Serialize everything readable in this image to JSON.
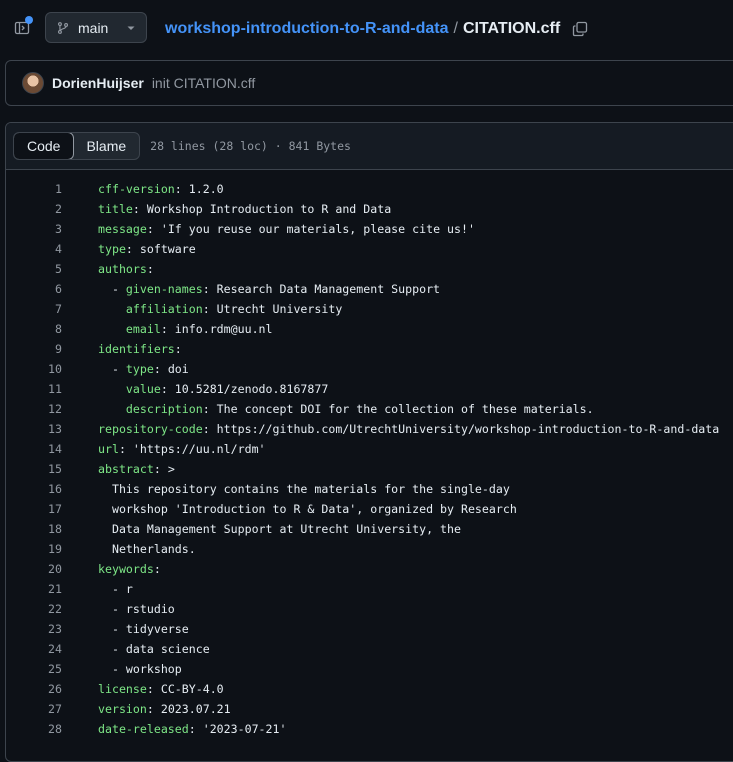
{
  "header": {
    "branch": "main",
    "repo": "workshop-introduction-to-R-and-data",
    "separator": "/",
    "file": "CITATION.cff"
  },
  "commit": {
    "author": "DorienHuijser",
    "message": "init CITATION.cff"
  },
  "file_view": {
    "tabs": [
      "Code",
      "Blame"
    ],
    "active_tab": "Code",
    "info": "28 lines (28 loc) · 841 Bytes"
  },
  "lines": [
    {
      "n": "1",
      "indent": "",
      "key": "cff-version",
      "sep": ": ",
      "val": "1.2.0"
    },
    {
      "n": "2",
      "indent": "",
      "key": "title",
      "sep": ": ",
      "val": "Workshop Introduction to R and Data"
    },
    {
      "n": "3",
      "indent": "",
      "key": "message",
      "sep": ": ",
      "val": "'If you reuse our materials, please cite us!'"
    },
    {
      "n": "4",
      "indent": "",
      "key": "type",
      "sep": ": ",
      "val": "software"
    },
    {
      "n": "5",
      "indent": "",
      "key": "authors",
      "sep": ":",
      "val": ""
    },
    {
      "n": "6",
      "indent": "  - ",
      "key": "given-names",
      "sep": ": ",
      "val": "Research Data Management Support"
    },
    {
      "n": "7",
      "indent": "    ",
      "key": "affiliation",
      "sep": ": ",
      "val": "Utrecht University"
    },
    {
      "n": "8",
      "indent": "    ",
      "key": "email",
      "sep": ": ",
      "val": "info.rdm@uu.nl"
    },
    {
      "n": "9",
      "indent": "",
      "key": "identifiers",
      "sep": ":",
      "val": ""
    },
    {
      "n": "10",
      "indent": "  - ",
      "key": "type",
      "sep": ": ",
      "val": "doi"
    },
    {
      "n": "11",
      "indent": "    ",
      "key": "value",
      "sep": ": ",
      "val": "10.5281/zenodo.8167877"
    },
    {
      "n": "12",
      "indent": "    ",
      "key": "description",
      "sep": ": ",
      "val": "The concept DOI for the collection of these materials."
    },
    {
      "n": "13",
      "indent": "",
      "key": "repository-code",
      "sep": ": ",
      "val": "https://github.com/UtrechtUniversity/workshop-introduction-to-R-and-data"
    },
    {
      "n": "14",
      "indent": "",
      "key": "url",
      "sep": ": ",
      "val": "'https://uu.nl/rdm'"
    },
    {
      "n": "15",
      "indent": "",
      "key": "abstract",
      "sep": ": ",
      "val": ">"
    },
    {
      "n": "16",
      "indent": "  ",
      "key": "",
      "sep": "",
      "val": "This repository contains the materials for the single-day"
    },
    {
      "n": "17",
      "indent": "  ",
      "key": "",
      "sep": "",
      "val": "workshop 'Introduction to R & Data', organized by Research"
    },
    {
      "n": "18",
      "indent": "  ",
      "key": "",
      "sep": "",
      "val": "Data Management Support at Utrecht University, the"
    },
    {
      "n": "19",
      "indent": "  ",
      "key": "",
      "sep": "",
      "val": "Netherlands."
    },
    {
      "n": "20",
      "indent": "",
      "key": "keywords",
      "sep": ":",
      "val": ""
    },
    {
      "n": "21",
      "indent": "  ",
      "key": "",
      "sep": "",
      "val": "- r"
    },
    {
      "n": "22",
      "indent": "  ",
      "key": "",
      "sep": "",
      "val": "- rstudio"
    },
    {
      "n": "23",
      "indent": "  ",
      "key": "",
      "sep": "",
      "val": "- tidyverse"
    },
    {
      "n": "24",
      "indent": "  ",
      "key": "",
      "sep": "",
      "val": "- data science"
    },
    {
      "n": "25",
      "indent": "  ",
      "key": "",
      "sep": "",
      "val": "- workshop"
    },
    {
      "n": "26",
      "indent": "",
      "key": "license",
      "sep": ": ",
      "val": "CC-BY-4.0"
    },
    {
      "n": "27",
      "indent": "",
      "key": "version",
      "sep": ": ",
      "val": "2023.07.21"
    },
    {
      "n": "28",
      "indent": "",
      "key": "date-released",
      "sep": ": ",
      "val": "'2023-07-21'"
    }
  ]
}
